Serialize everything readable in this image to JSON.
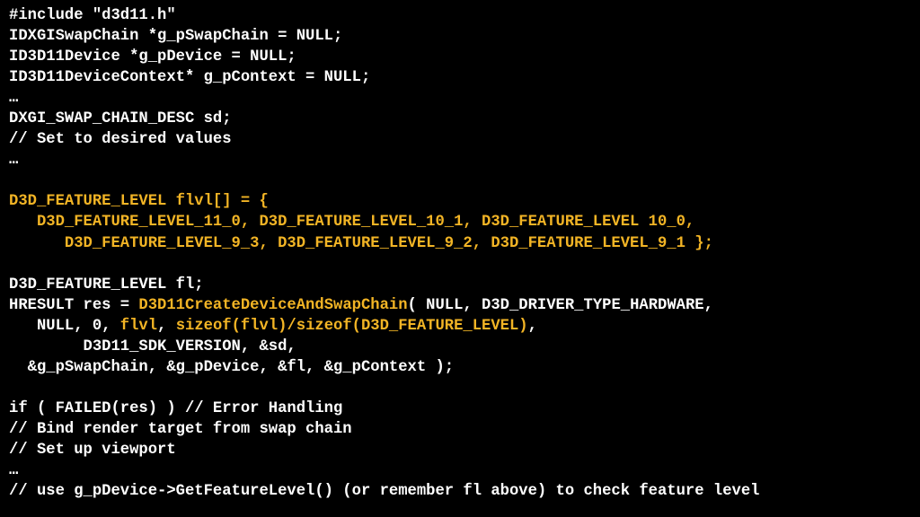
{
  "code": {
    "l01": "#include \"d3d11.h\"",
    "l02": "IDXGISwapChain *g_pSwapChain = NULL;",
    "l03": "ID3D11Device *g_pDevice = NULL;",
    "l04": "ID3D11DeviceContext* g_pContext = NULL;",
    "l05": "…",
    "l06": "DXGI_SWAP_CHAIN_DESC sd;",
    "l07": "// Set to desired values",
    "l08": "…",
    "l09": "",
    "l10": "D3D_FEATURE_LEVEL flvl[] = {",
    "l11": "   D3D_FEATURE_LEVEL_11_0, D3D_FEATURE_LEVEL_10_1, D3D_FEATURE_LEVEL 10_0,",
    "l12": "      D3D_FEATURE_LEVEL_9_3, D3D_FEATURE_LEVEL_9_2, D3D_FEATURE_LEVEL_9_1 };",
    "l13": "",
    "l14": "D3D_FEATURE_LEVEL fl;",
    "l15a": "HRESULT res = ",
    "l15b": "D3D11CreateDeviceAndSwapChain",
    "l15c": "( NULL, D3D_DRIVER_TYPE_HARDWARE,",
    "l16a": "   NULL, 0, ",
    "l16b": "flvl",
    "l16c": ", ",
    "l16d": "sizeof(flvl)/sizeof(D3D_FEATURE_LEVEL)",
    "l16e": ",",
    "l17": "        D3D11_SDK_VERSION, &sd,",
    "l18": "  &g_pSwapChain, &g_pDevice, &fl, &g_pContext );",
    "l19": "",
    "l20": "if ( FAILED(res) ) // Error Handling",
    "l21": "// Bind render target from swap chain",
    "l22": "// Set up viewport",
    "l23": "…",
    "l24": "// use g_pDevice->GetFeatureLevel() (or remember fl above) to check feature level"
  }
}
